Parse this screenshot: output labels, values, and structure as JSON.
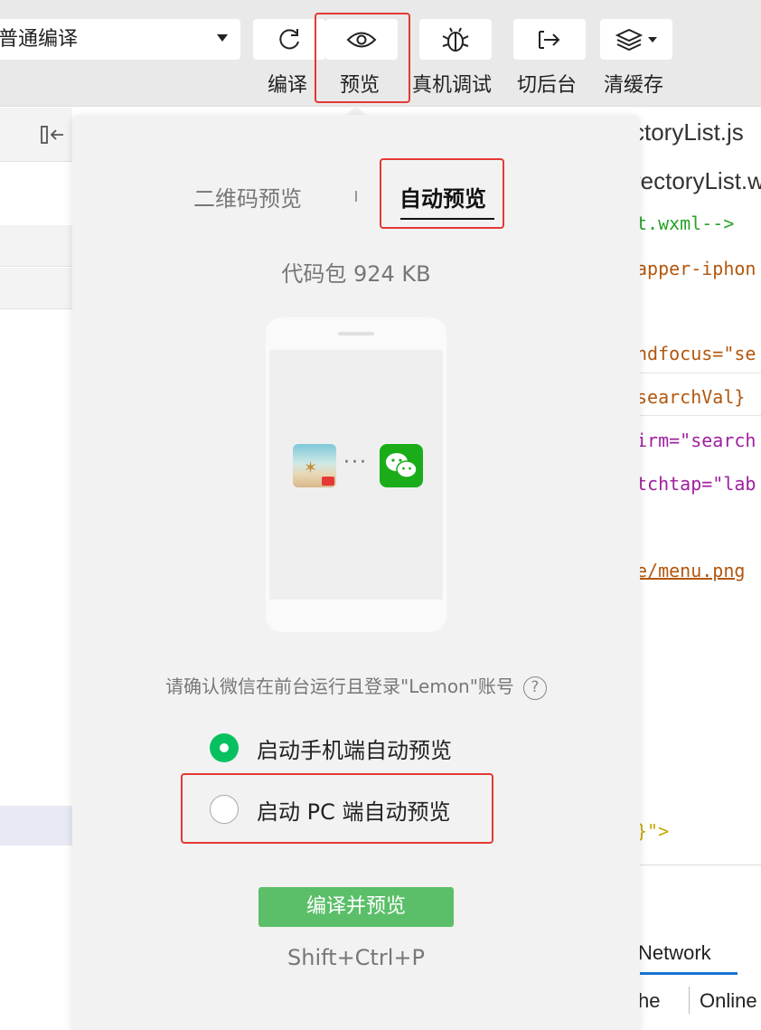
{
  "toolbar": {
    "compile_mode": "普通编译",
    "compile_label": "编译",
    "preview_label": "预览",
    "debug_label": "真机调试",
    "background_label": "切后台",
    "cache_label": "清缓存",
    "icons": [
      "refresh-icon",
      "eye-icon",
      "bug-icon",
      "switch-background-icon",
      "layers-icon"
    ]
  },
  "popup": {
    "tabs": [
      "二维码预览",
      "自动预览"
    ],
    "active_tab": "自动预览",
    "package_size": "代码包 924 KB",
    "confirm_text": "请确认微信在前台运行且登录\"Lemon\"账号",
    "help_glyph": "?",
    "radio_options": [
      {
        "label": "启动手机端自动预览",
        "checked": true
      },
      {
        "label": "启动 PC 端自动预览",
        "checked": false
      }
    ],
    "compile_button": "编译并预览",
    "shortcut": "Shift+Ctrl+P",
    "accent_color": "#07c160"
  },
  "editor": {
    "tab1": "ctoryList.js",
    "tab2": "rectoryList.w",
    "lines": [
      {
        "text": "t.wxml-->"
      },
      {
        "text": "apper-iphon"
      },
      {
        "text": "ndfocus=\"se"
      },
      {
        "text": "searchVal}"
      },
      {
        "text": "irm=\"search"
      },
      {
        "text": "tchtap=\"lab"
      },
      {
        "text": "e/menu.png"
      },
      {
        "text": "}\">"
      }
    ]
  },
  "devtools": {
    "network_tab": "Network",
    "cache_text": "he",
    "online_text": "Online"
  }
}
